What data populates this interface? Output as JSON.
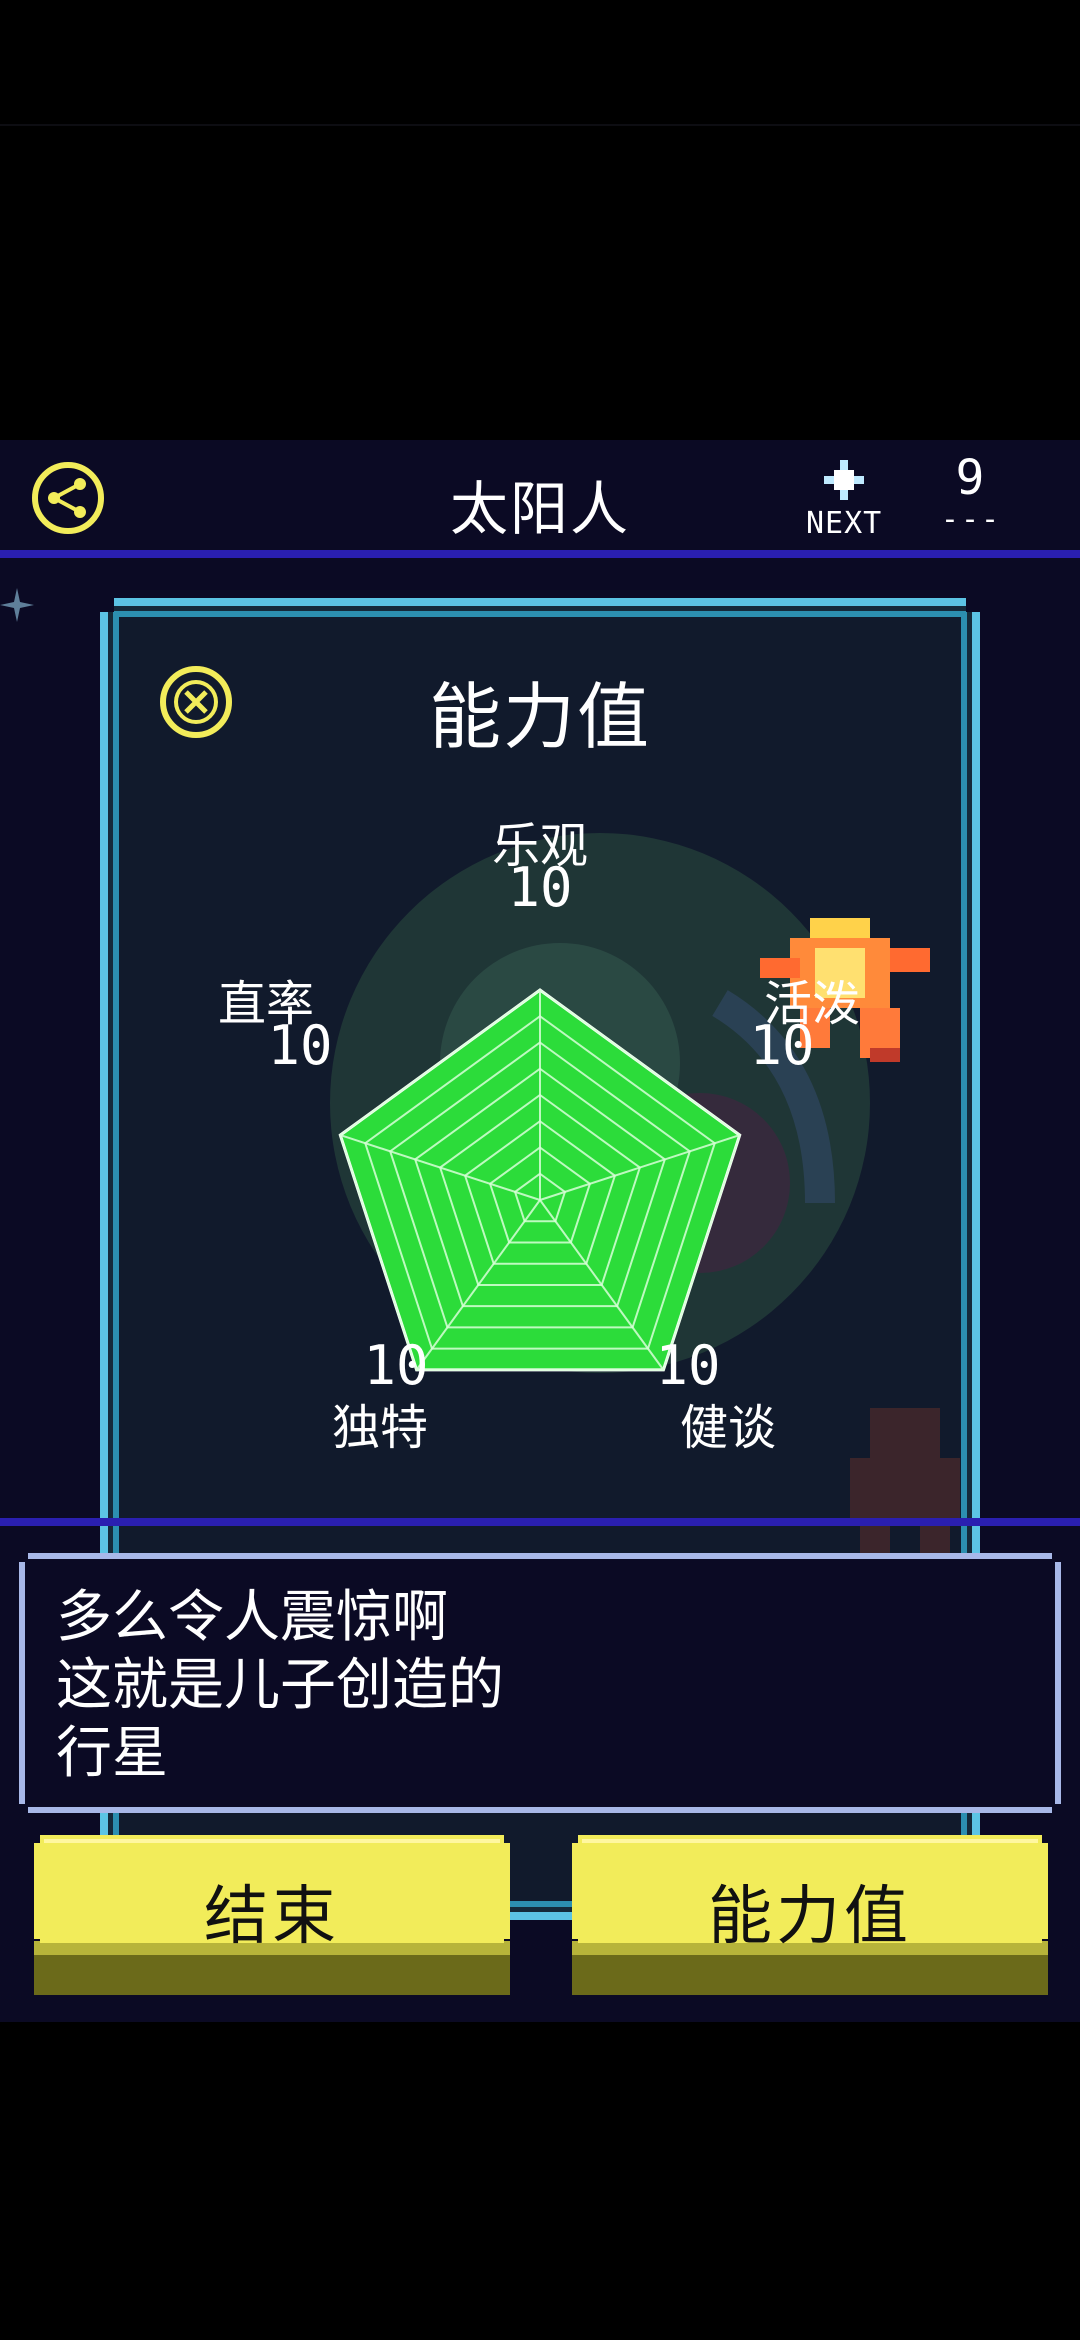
{
  "header": {
    "title": "太阳人",
    "next_label": "NEXT",
    "next_count": "9",
    "next_dashes": "---"
  },
  "stats_panel": {
    "title": "能力值",
    "stats": [
      {
        "name": "乐观",
        "value": 10
      },
      {
        "name": "活泼",
        "value": 10
      },
      {
        "name": "健谈",
        "value": 10
      },
      {
        "name": "独特",
        "value": 10
      },
      {
        "name": "直率",
        "value": 10
      }
    ],
    "max_value": 10,
    "fill_color": "#2cdc3a",
    "grid_color": "#d8ffd8"
  },
  "message": {
    "lines": [
      "多么令人震惊啊",
      "这就是儿子创造的",
      "行星"
    ]
  },
  "buttons": {
    "end_label": "结束",
    "stats_label": "能力值"
  },
  "colors": {
    "accent_yellow": "#f2ec5a",
    "panel_border": "#5cc4e4",
    "header_rule": "#2a1fb0",
    "background": "#0b0a24"
  },
  "icons": {
    "share": "share-icon",
    "close": "close-icon",
    "next_star": "star-icon"
  }
}
